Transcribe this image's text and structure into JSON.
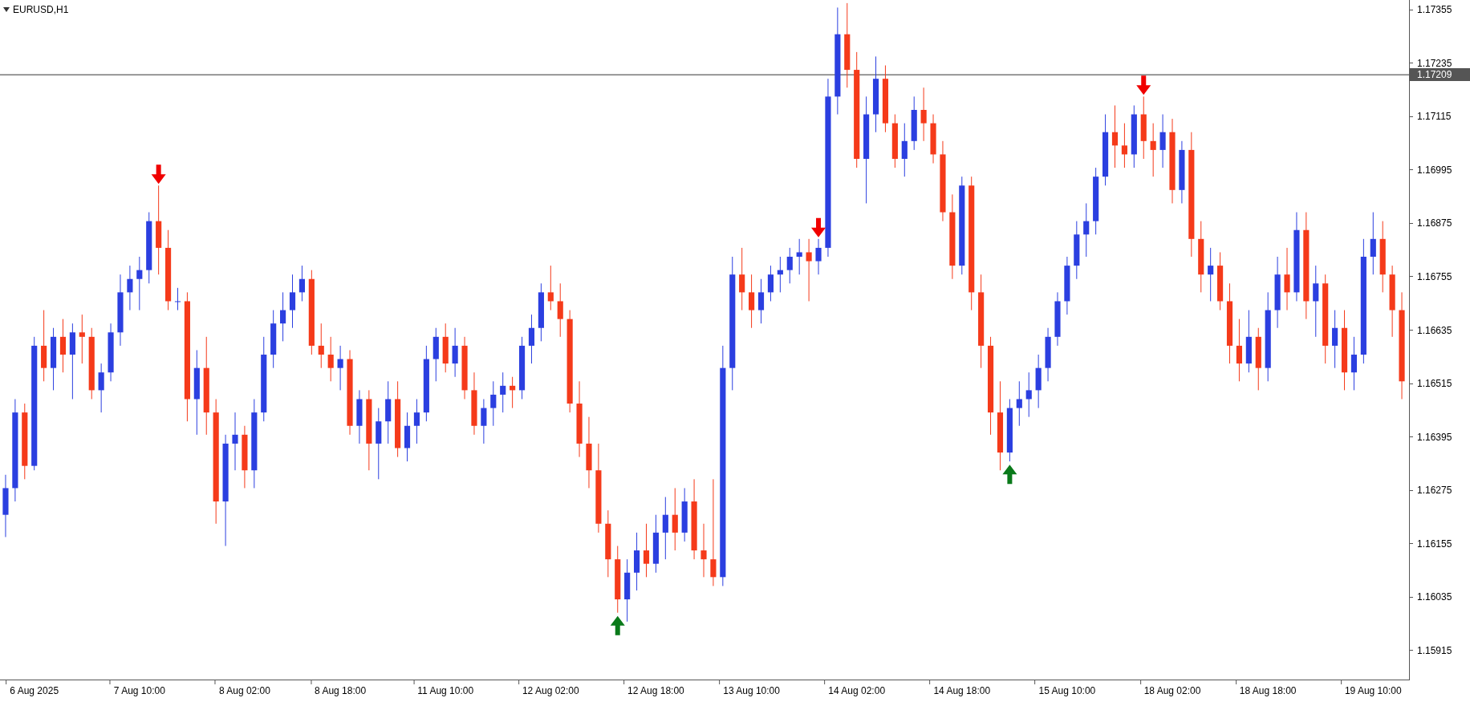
{
  "chart": {
    "title": "EURUSD,H1",
    "chart_data": {
      "type": "candlestick",
      "ylim": [
        1.15848,
        1.17377
      ],
      "yticks": [
        {
          "value": 1.17355,
          "label": "1.17355"
        },
        {
          "value": 1.17235,
          "label": "1.17235"
        },
        {
          "value": 1.17115,
          "label": "1.17115"
        },
        {
          "value": 1.16995,
          "label": "1.16995"
        },
        {
          "value": 1.16875,
          "label": "1.16875"
        },
        {
          "value": 1.16755,
          "label": "1.16755"
        },
        {
          "value": 1.16635,
          "label": "1.16635"
        },
        {
          "value": 1.16515,
          "label": "1.16515"
        },
        {
          "value": 1.16395,
          "label": "1.16395"
        },
        {
          "value": 1.16275,
          "label": "1.16275"
        },
        {
          "value": 1.16155,
          "label": "1.16155"
        },
        {
          "value": 1.16035,
          "label": "1.16035"
        },
        {
          "value": 1.15915,
          "label": "1.15915"
        }
      ],
      "ref_lines": [
        {
          "axis": "y",
          "value": 1.17209,
          "label": "1.17209"
        }
      ],
      "categories": [
        null,
        null,
        null,
        "6 Aug 2025",
        null,
        null,
        null,
        null,
        null,
        null,
        null,
        null,
        null,
        null,
        "7 Aug 10:00",
        null,
        null,
        null,
        null,
        null,
        null,
        null,
        null,
        null,
        null,
        "8 Aug 02:00",
        null,
        null,
        null,
        null,
        null,
        null,
        null,
        null,
        null,
        "8 Aug 18:00",
        null,
        null,
        null,
        null,
        null,
        null,
        null,
        null,
        null,
        null,
        "11 Aug 10:00",
        null,
        null,
        null,
        null,
        null,
        null,
        null,
        null,
        null,
        null,
        "12 Aug 02:00",
        null,
        null,
        null,
        null,
        null,
        null,
        null,
        null,
        null,
        null,
        "12 Aug 18:00",
        null,
        null,
        null,
        null,
        null,
        null,
        null,
        null,
        null,
        "13 Aug 10:00",
        null,
        null,
        null,
        null,
        null,
        null,
        null,
        null,
        null,
        null,
        "14 Aug 02:00",
        null,
        null,
        null,
        null,
        null,
        null,
        null,
        null,
        null,
        null,
        "14 Aug 18:00",
        null,
        null,
        null,
        null,
        null,
        null,
        null,
        null,
        null,
        null,
        "15 Aug 10:00",
        null,
        null,
        null,
        null,
        null,
        null,
        null,
        null,
        null,
        null,
        "18 Aug 02:00",
        null,
        null,
        null,
        null,
        null,
        null,
        null,
        null,
        null,
        "18 Aug 18:00",
        null,
        null,
        null,
        null,
        null,
        null,
        null,
        null,
        null,
        null,
        "19 Aug 10:00",
        null,
        null,
        null
      ],
      "ohlc": [
        [
          1.1622,
          1.1631,
          1.1617,
          1.1628
        ],
        [
          1.1628,
          1.1648,
          1.1625,
          1.1645
        ],
        [
          1.1645,
          1.1647,
          1.163,
          1.1633
        ],
        [
          1.1633,
          1.1662,
          1.1632,
          1.166
        ],
        [
          1.166,
          1.1668,
          1.1652,
          1.1655
        ],
        [
          1.1655,
          1.1664,
          1.165,
          1.1662
        ],
        [
          1.1662,
          1.1666,
          1.1654,
          1.1658
        ],
        [
          1.1658,
          1.1665,
          1.1648,
          1.1663
        ],
        [
          1.1663,
          1.1667,
          1.1656,
          1.1662
        ],
        [
          1.1662,
          1.1664,
          1.1648,
          1.165
        ],
        [
          1.165,
          1.1656,
          1.1645,
          1.1654
        ],
        [
          1.1654,
          1.1665,
          1.1652,
          1.1663
        ],
        [
          1.1663,
          1.1676,
          1.166,
          1.1672
        ],
        [
          1.1672,
          1.1678,
          1.1668,
          1.1675
        ],
        [
          1.1675,
          1.168,
          1.1668,
          1.1677
        ],
        [
          1.1677,
          1.169,
          1.1674,
          1.1688
        ],
        [
          1.1688,
          1.1696,
          1.1676,
          1.1682
        ],
        [
          1.1682,
          1.1686,
          1.1668,
          1.167
        ],
        [
          1.167,
          1.1673,
          1.1668,
          1.167
        ],
        [
          1.167,
          1.1672,
          1.1643,
          1.1648
        ],
        [
          1.1648,
          1.1659,
          1.164,
          1.1655
        ],
        [
          1.1655,
          1.1662,
          1.164,
          1.1645
        ],
        [
          1.1645,
          1.1648,
          1.162,
          1.1625
        ],
        [
          1.1625,
          1.164,
          1.1615,
          1.1638
        ],
        [
          1.1638,
          1.1645,
          1.1632,
          1.164
        ],
        [
          1.164,
          1.1642,
          1.1628,
          1.1632
        ],
        [
          1.1632,
          1.1648,
          1.1628,
          1.1645
        ],
        [
          1.1645,
          1.1662,
          1.1643,
          1.1658
        ],
        [
          1.1658,
          1.1668,
          1.1655,
          1.1665
        ],
        [
          1.1665,
          1.1672,
          1.1661,
          1.1668
        ],
        [
          1.1668,
          1.1676,
          1.1664,
          1.1672
        ],
        [
          1.1672,
          1.1678,
          1.167,
          1.1675
        ],
        [
          1.1675,
          1.1677,
          1.1658,
          1.166
        ],
        [
          1.166,
          1.1665,
          1.1655,
          1.1658
        ],
        [
          1.1658,
          1.1662,
          1.1652,
          1.1655
        ],
        [
          1.1655,
          1.166,
          1.165,
          1.1657
        ],
        [
          1.1657,
          1.1659,
          1.164,
          1.1642
        ],
        [
          1.1642,
          1.165,
          1.1638,
          1.1648
        ],
        [
          1.1648,
          1.165,
          1.1632,
          1.1638
        ],
        [
          1.1638,
          1.1646,
          1.163,
          1.1643
        ],
        [
          1.1643,
          1.1652,
          1.1638,
          1.1648
        ],
        [
          1.1648,
          1.1652,
          1.1635,
          1.1637
        ],
        [
          1.1637,
          1.1645,
          1.1634,
          1.1642
        ],
        [
          1.1642,
          1.1648,
          1.1638,
          1.1645
        ],
        [
          1.1645,
          1.166,
          1.1643,
          1.1657
        ],
        [
          1.1657,
          1.1664,
          1.1652,
          1.1662
        ],
        [
          1.1662,
          1.1665,
          1.1654,
          1.1656
        ],
        [
          1.1656,
          1.1664,
          1.1653,
          1.166
        ],
        [
          1.166,
          1.1662,
          1.1648,
          1.165
        ],
        [
          1.165,
          1.1654,
          1.164,
          1.1642
        ],
        [
          1.1642,
          1.1648,
          1.1638,
          1.1646
        ],
        [
          1.1646,
          1.1652,
          1.1642,
          1.1649
        ],
        [
          1.1649,
          1.1654,
          1.1645,
          1.1651
        ],
        [
          1.1651,
          1.1653,
          1.1646,
          1.165
        ],
        [
          1.165,
          1.1662,
          1.1648,
          1.166
        ],
        [
          1.166,
          1.1667,
          1.1656,
          1.1664
        ],
        [
          1.1664,
          1.1674,
          1.1661,
          1.1672
        ],
        [
          1.1672,
          1.1678,
          1.1668,
          1.167
        ],
        [
          1.167,
          1.1674,
          1.1662,
          1.1666
        ],
        [
          1.1666,
          1.1668,
          1.1645,
          1.1647
        ],
        [
          1.1647,
          1.1652,
          1.1635,
          1.1638
        ],
        [
          1.1638,
          1.1644,
          1.1628,
          1.1632
        ],
        [
          1.1632,
          1.1638,
          1.1618,
          1.162
        ],
        [
          1.162,
          1.1623,
          1.1608,
          1.1612
        ],
        [
          1.1612,
          1.1615,
          1.16,
          1.1603
        ],
        [
          1.1603,
          1.1612,
          1.1598,
          1.1609
        ],
        [
          1.1609,
          1.1618,
          1.1605,
          1.1614
        ],
        [
          1.1614,
          1.162,
          1.1608,
          1.1611
        ],
        [
          1.1611,
          1.1622,
          1.1609,
          1.1618
        ],
        [
          1.1618,
          1.1626,
          1.1612,
          1.1622
        ],
        [
          1.1622,
          1.1628,
          1.1614,
          1.1618
        ],
        [
          1.1618,
          1.1628,
          1.1616,
          1.1625
        ],
        [
          1.1625,
          1.163,
          1.1612,
          1.1614
        ],
        [
          1.1614,
          1.162,
          1.1608,
          1.1612
        ],
        [
          1.1612,
          1.163,
          1.1606,
          1.1608
        ],
        [
          1.1608,
          1.166,
          1.1606,
          1.1655
        ],
        [
          1.1655,
          1.168,
          1.165,
          1.1676
        ],
        [
          1.1676,
          1.1682,
          1.1668,
          1.1672
        ],
        [
          1.1672,
          1.1676,
          1.1664,
          1.1668
        ],
        [
          1.1668,
          1.1675,
          1.1665,
          1.1672
        ],
        [
          1.1672,
          1.1678,
          1.167,
          1.1676
        ],
        [
          1.1676,
          1.168,
          1.1672,
          1.1677
        ],
        [
          1.1677,
          1.1682,
          1.1674,
          1.168
        ],
        [
          1.168,
          1.1684,
          1.1676,
          1.1681
        ],
        [
          1.1681,
          1.1684,
          1.167,
          1.1679
        ],
        [
          1.1679,
          1.1684,
          1.1676,
          1.1682
        ],
        [
          1.1682,
          1.172,
          1.168,
          1.1716
        ],
        [
          1.1716,
          1.1736,
          1.1712,
          1.173
        ],
        [
          1.173,
          1.1737,
          1.1718,
          1.1722
        ],
        [
          1.1722,
          1.1726,
          1.17,
          1.1702
        ],
        [
          1.1702,
          1.1716,
          1.1692,
          1.1712
        ],
        [
          1.1712,
          1.1725,
          1.1708,
          1.172
        ],
        [
          1.172,
          1.1723,
          1.1708,
          1.171
        ],
        [
          1.171,
          1.1712,
          1.17,
          1.1702
        ],
        [
          1.1702,
          1.171,
          1.1698,
          1.1706
        ],
        [
          1.1706,
          1.1716,
          1.1704,
          1.1713
        ],
        [
          1.1713,
          1.1718,
          1.1706,
          1.171
        ],
        [
          1.171,
          1.1712,
          1.1701,
          1.1703
        ],
        [
          1.1703,
          1.1706,
          1.1688,
          1.169
        ],
        [
          1.169,
          1.1694,
          1.1675,
          1.1678
        ],
        [
          1.1678,
          1.1698,
          1.1676,
          1.1696
        ],
        [
          1.1696,
          1.1698,
          1.1668,
          1.1672
        ],
        [
          1.1672,
          1.1676,
          1.1655,
          1.166
        ],
        [
          1.166,
          1.1662,
          1.164,
          1.1645
        ],
        [
          1.1645,
          1.1652,
          1.1632,
          1.1636
        ],
        [
          1.1636,
          1.1648,
          1.1634,
          1.1646
        ],
        [
          1.1646,
          1.1652,
          1.1642,
          1.1648
        ],
        [
          1.1648,
          1.1654,
          1.1644,
          1.165
        ],
        [
          1.165,
          1.1658,
          1.1646,
          1.1655
        ],
        [
          1.1655,
          1.1664,
          1.1652,
          1.1662
        ],
        [
          1.1662,
          1.1672,
          1.166,
          1.167
        ],
        [
          1.167,
          1.168,
          1.1667,
          1.1678
        ],
        [
          1.1678,
          1.1688,
          1.1675,
          1.1685
        ],
        [
          1.1685,
          1.1692,
          1.168,
          1.1688
        ],
        [
          1.1688,
          1.17,
          1.1685,
          1.1698
        ],
        [
          1.1698,
          1.1712,
          1.1696,
          1.1708
        ],
        [
          1.1708,
          1.1714,
          1.17,
          1.1705
        ],
        [
          1.1705,
          1.171,
          1.17,
          1.1703
        ],
        [
          1.1703,
          1.1714,
          1.17,
          1.1712
        ],
        [
          1.1712,
          1.1716,
          1.1702,
          1.1706
        ],
        [
          1.1706,
          1.171,
          1.1698,
          1.1704
        ],
        [
          1.1704,
          1.1712,
          1.17,
          1.1708
        ],
        [
          1.1708,
          1.1711,
          1.1692,
          1.1695
        ],
        [
          1.1695,
          1.1706,
          1.1692,
          1.1704
        ],
        [
          1.1704,
          1.1708,
          1.168,
          1.1684
        ],
        [
          1.1684,
          1.1688,
          1.1672,
          1.1676
        ],
        [
          1.1676,
          1.1682,
          1.167,
          1.1678
        ],
        [
          1.1678,
          1.1681,
          1.1668,
          1.167
        ],
        [
          1.167,
          1.1674,
          1.1656,
          1.166
        ],
        [
          1.166,
          1.1666,
          1.1652,
          1.1656
        ],
        [
          1.1656,
          1.1668,
          1.1654,
          1.1662
        ],
        [
          1.1662,
          1.1664,
          1.165,
          1.1655
        ],
        [
          1.1655,
          1.1672,
          1.1652,
          1.1668
        ],
        [
          1.1668,
          1.168,
          1.1664,
          1.1676
        ],
        [
          1.1676,
          1.1682,
          1.1668,
          1.1672
        ],
        [
          1.1672,
          1.169,
          1.167,
          1.1686
        ],
        [
          1.1686,
          1.169,
          1.1666,
          1.167
        ],
        [
          1.167,
          1.1678,
          1.1662,
          1.1674
        ],
        [
          1.1674,
          1.1676,
          1.1656,
          1.166
        ],
        [
          1.166,
          1.1668,
          1.1655,
          1.1664
        ],
        [
          1.1664,
          1.1668,
          1.165,
          1.1654
        ],
        [
          1.1654,
          1.1662,
          1.165,
          1.1658
        ],
        [
          1.1658,
          1.1684,
          1.1656,
          1.168
        ],
        [
          1.168,
          1.169,
          1.1676,
          1.1684
        ],
        [
          1.1684,
          1.1688,
          1.1672,
          1.1676
        ],
        [
          1.1676,
          1.1678,
          1.1662,
          1.1668
        ],
        [
          1.1668,
          1.1672,
          1.1648,
          1.1652
        ]
      ]
    }
  }
}
